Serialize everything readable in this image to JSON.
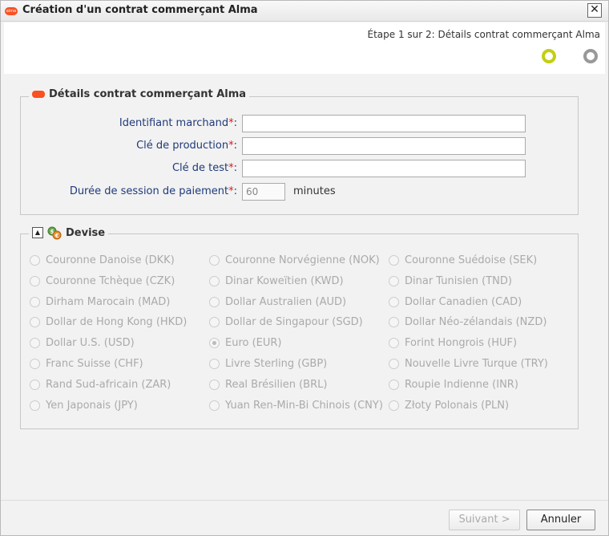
{
  "window": {
    "title": "Création d'un contrat commerçant Alma",
    "close_label": "✕"
  },
  "stepper": {
    "text": "Étape 1 sur 2: Détails contrat commerçant Alma",
    "current_step": 1,
    "total_steps": 2
  },
  "contract_section": {
    "legend": "Détails contrat commerçant Alma",
    "fields": [
      {
        "label": "Identifiant marchand",
        "required_mark": "*",
        "suffix": ":",
        "value": ""
      },
      {
        "label": "Clé de production",
        "required_mark": "*",
        "suffix": ":",
        "value": ""
      },
      {
        "label": "Clé de test",
        "required_mark": "*",
        "suffix": ":",
        "value": ""
      },
      {
        "label": "Durée de session de paiement",
        "required_mark": "*",
        "suffix": ":",
        "value": "60",
        "unit": "minutes"
      }
    ]
  },
  "currency_section": {
    "legend": "Devise",
    "collapse_icon": "▲",
    "options": [
      "Couronne Danoise (DKK)",
      "Couronne Norvégienne (NOK)",
      "Couronne Suédoise (SEK)",
      "Couronne Tchèque (CZK)",
      "Dinar Koweïtien (KWD)",
      "Dinar Tunisien (TND)",
      "Dirham Marocain (MAD)",
      "Dollar Australien (AUD)",
      "Dollar Canadien (CAD)",
      "Dollar de Hong Kong (HKD)",
      "Dollar de Singapour (SGD)",
      "Dollar Néo-zélandais (NZD)",
      "Dollar U.S. (USD)",
      "Euro (EUR)",
      "Forint Hongrois (HUF)",
      "Franc Suisse (CHF)",
      "Livre Sterling (GBP)",
      "Nouvelle Livre Turque (TRY)",
      "Rand Sud-africain (ZAR)",
      "Real Brésilien (BRL)",
      "Roupie Indienne (INR)",
      "Yen Japonais (JPY)",
      "Yuan Ren-Min-Bi Chinois (CNY)",
      "Złoty Polonais (PLN)"
    ],
    "selected": "Euro (EUR)"
  },
  "footer": {
    "next_label": "Suivant >",
    "cancel_label": "Annuler"
  },
  "colors": {
    "brand": "#fa5022",
    "step_active": "#c3cf12",
    "step_inactive": "#999999",
    "label_blue": "#1f3a7a",
    "required_red": "#d52020"
  }
}
